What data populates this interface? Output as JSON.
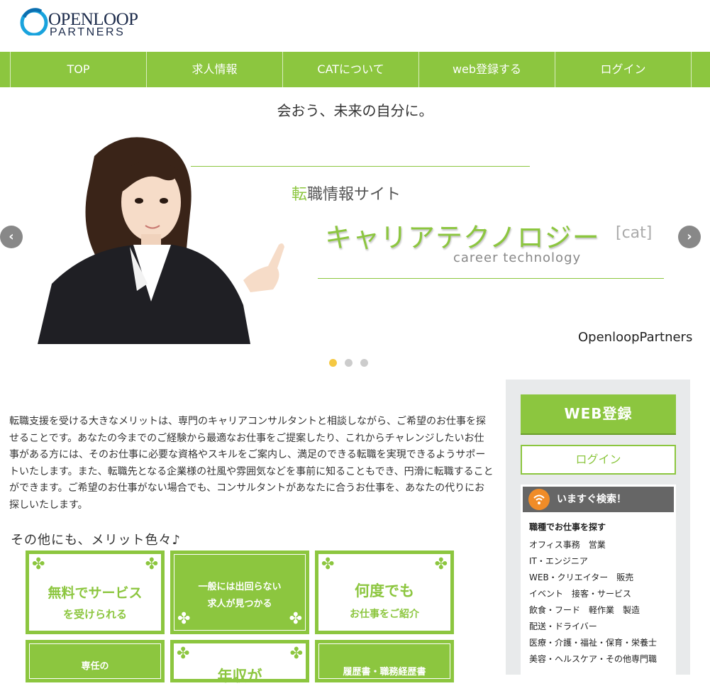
{
  "logo": {
    "line1": "OPENLOOP",
    "line2": "PARTNERS"
  },
  "nav": {
    "items": [
      "TOP",
      "求人情報",
      "CATについて",
      "web登録する",
      "ログイン"
    ]
  },
  "tagline": "会おう、未来の自分に。",
  "slide": {
    "sub_accent": "転",
    "sub_rest": "職情報サイト",
    "main": "キャリアテクノロジー",
    "cat": "[cat]",
    "english": "career technology",
    "brand": "OpenloopPartners",
    "prev_label": "‹",
    "next_label": "›",
    "active_dot": 1,
    "dot_count": 3
  },
  "intro": "転職支援を受ける大きなメリットは、専門のキャリアコンサルタントと相談しながら、ご希望のお仕事を探せることです。あなたの今までのご経験から最適なお仕事をご提案したり、これからチャレンジしたいお仕事がある方には、そのお仕事に必要な資格やスキルをご案内し、満足のできる転職を実現できるようサポートいたします。また、転職先となる企業様の社風や雰囲気などを事前に知ることもでき、円滑に転職することができます。ご希望のお仕事がない場合でも、コンサルタントがあなたに合うお仕事を、あなたの代りにお探しいたします。",
  "merits": {
    "heading": "その他にも、メリット色々♪",
    "cards": [
      {
        "line1": "無料でサービス",
        "line2": "を受けられる"
      },
      {
        "line1": "一般には出回らない",
        "line2": "求人が見つかる"
      },
      {
        "line1": "何度でも",
        "line2": "お仕事をご紹介"
      },
      {
        "line1": "専任の",
        "line2": ""
      },
      {
        "line1": "年収が",
        "line2": ""
      },
      {
        "line1": "履歴書・職務経歴書",
        "line2": ""
      }
    ]
  },
  "sidebar": {
    "web_button": "WEB登録",
    "login_button": "ログイン",
    "search_title": "いますぐ検索！",
    "category_title": "職種でお仕事を探す",
    "categories": [
      "オフィス事務　営業",
      "IT・エンジニア",
      "WEB・クリエイター　販売",
      "イベント　接客・サービス",
      "飲食・フード　軽作業　製造",
      "配送・ドライバー",
      "医療・介護・福祉・保育・栄養士",
      "美容・ヘルスケア・その他専門職"
    ]
  },
  "colors": {
    "accent": "#8cc63f",
    "dot_active": "#f5c842",
    "search_icon": "#f08c28"
  }
}
